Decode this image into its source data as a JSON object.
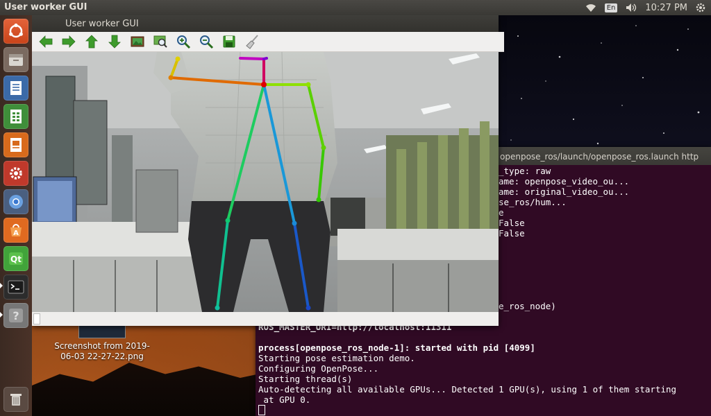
{
  "topbar": {
    "app_title": "User worker GUI",
    "keyboard": "En",
    "clock": "10:27 PM"
  },
  "desktop": {
    "file_label_line1": "Screenshot from 2019-",
    "file_label_line2": "06-03 22-27-22.png"
  },
  "terminal": {
    "title": "openpose_ros/launch/openpose_ros.launch http",
    "lines": [
      "_type: raw",
      "ame: openpose_video_ou...",
      "ame: original_video_ou...",
      "se_ros/hum...",
      "e",
      "False",
      "False",
      "e_ros_node)",
      "ROS_MASTER_URI=http://localhost:11311",
      "process[openpose_ros_node-1]: started with pid [4099]",
      "Starting pose estimation demo.",
      "Configuring OpenPose...",
      "Starting thread(s)",
      "Auto-detecting all available GPUs... Detected 1 GPU(s), using 1 of them starting",
      " at GPU 0."
    ]
  },
  "gui_window": {
    "title": "User worker GUI",
    "toolbar": [
      {
        "name": "back-arrow-icon"
      },
      {
        "name": "forward-arrow-icon"
      },
      {
        "name": "up-arrow-icon"
      },
      {
        "name": "down-arrow-icon"
      },
      {
        "name": "image-icon"
      },
      {
        "name": "fit-view-icon"
      },
      {
        "name": "zoom-in-icon"
      },
      {
        "name": "zoom-out-icon"
      },
      {
        "name": "save-icon"
      },
      {
        "name": "clear-broom-icon"
      }
    ]
  },
  "launcher": [
    "ubuntu-dash-icon",
    "files-icon",
    "writer-icon",
    "calc-icon",
    "impress-icon",
    "settings-icon",
    "chromium-icon",
    "software-center-icon",
    "qt-creator-icon",
    "terminal-icon",
    "unknown-app-icon",
    "trash-icon"
  ],
  "colors": {
    "terminal_bg": "#300a24",
    "ubuntu_orange": "#dd4814"
  }
}
